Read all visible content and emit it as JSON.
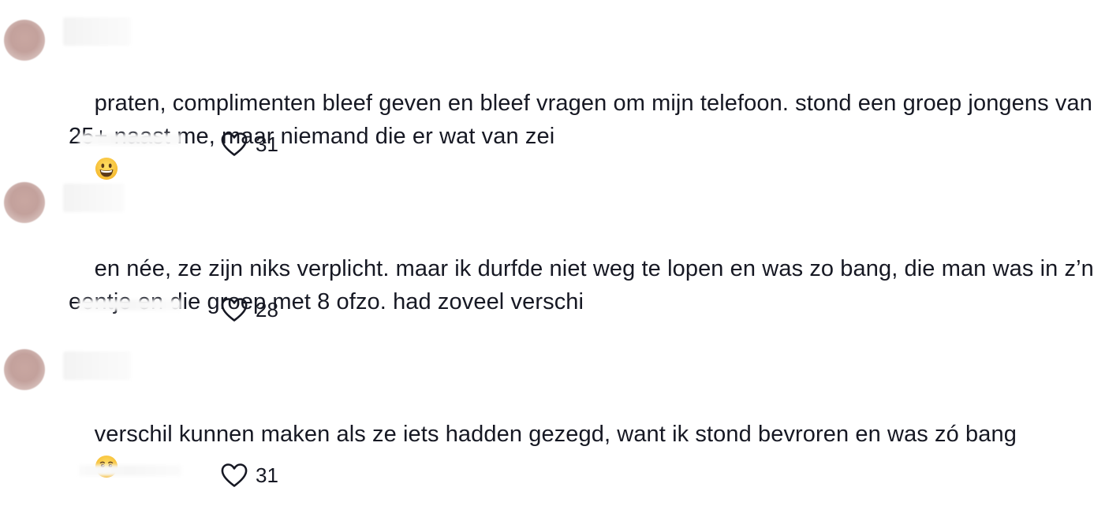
{
  "comments": [
    {
      "text": "praten, complimenten bleef geven en bleef vragen om mijn telefoon. stond een groep jongens van 25+ naast me, maar niemand die er wat van zei",
      "emoji": "grinning-face",
      "likes": "31"
    },
    {
      "text": "en née, ze zijn niks verplicht. maar ik durfde niet weg te lopen en was zo bang, die man was in z’n eentje en die groep met 8 ofzo. had zoveel verschi",
      "emoji": "",
      "likes": "28"
    },
    {
      "text": "verschil kunnen maken als ze iets hadden gezegd, want ik stond bevroren en was zó bang",
      "emoji": "face-holding-back-tears",
      "likes": "31"
    }
  ],
  "colors": {
    "text": "#161823",
    "background": "#ffffff",
    "emoji_yellow": "#f7c132"
  },
  "icons": {
    "like": "heart-outline-icon"
  }
}
